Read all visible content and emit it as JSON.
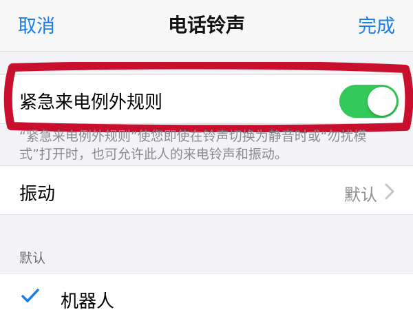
{
  "navbar": {
    "cancel_label": "取消",
    "title": "电话铃声",
    "done_label": "完成"
  },
  "emergency_bypass": {
    "label": "紧急来电例外规则",
    "enabled": true,
    "description": "“紧急来电例外规则”使您即使在铃声切换为静音时或“勿扰模式”打开时，也可允许此人的来电铃声和振动。"
  },
  "vibration": {
    "label": "振动",
    "value": "默认"
  },
  "ringtones": {
    "section_header": "默认",
    "items": [
      {
        "label": "机器人",
        "selected": true
      }
    ]
  },
  "colors": {
    "accent": "#1a7ee6",
    "switch_on": "#34c759",
    "highlight": "#c8102e"
  }
}
